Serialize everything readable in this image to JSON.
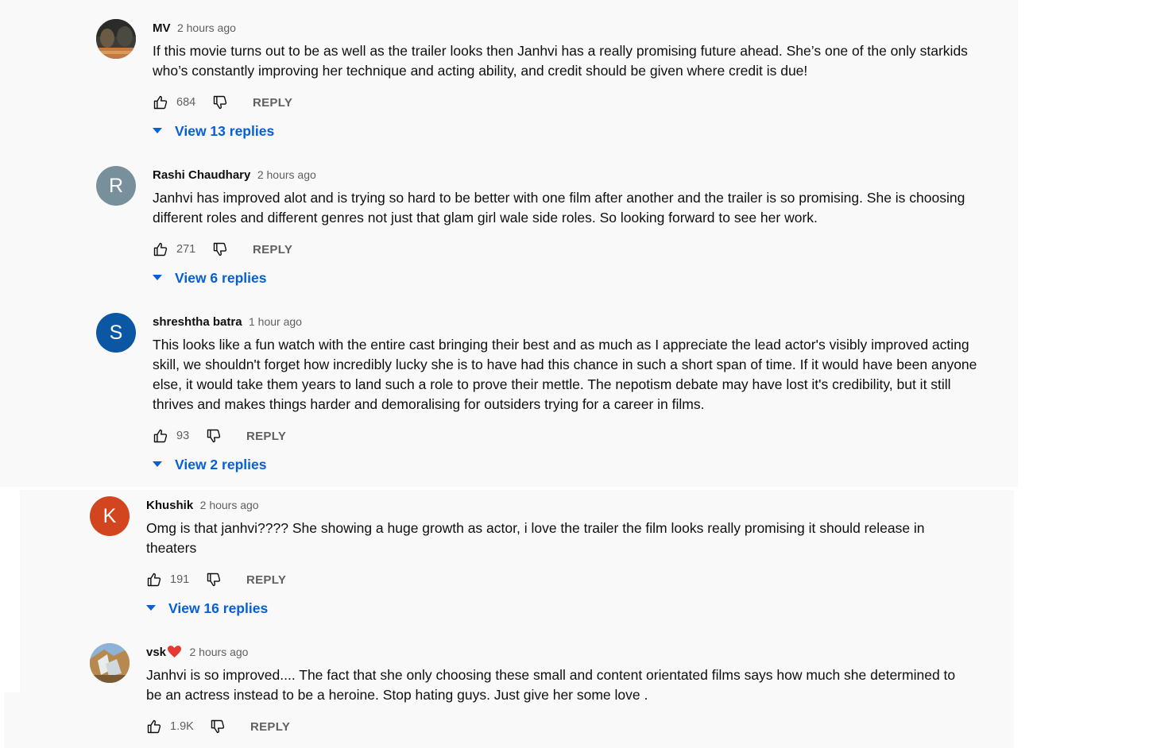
{
  "comments": [
    {
      "author": "MV",
      "time": "2 hours ago",
      "text": "If this movie turns out to be as well as the trailer looks then Janhvi has a really  promising future ahead. She’s one of the only starkids who’s constantly improving her technique and acting ability, and credit should be given where credit is due!",
      "likes": "684",
      "reply_label": "REPLY",
      "replies_label": "View 13 replies",
      "avatar_letter": ""
    },
    {
      "author": "Rashi Chaudhary",
      "time": "2 hours ago",
      "text": "Janhvi has improved alot and is trying so hard to be better with one film after another and the trailer is so promising. She is choosing different roles and different genres not just that glam girl wale side roles. So looking forward to see her work.",
      "likes": "271",
      "reply_label": "REPLY",
      "replies_label": "View 6 replies",
      "avatar_letter": "R",
      "avatar_color": "#78909c"
    },
    {
      "author": "shreshtha batra",
      "time": "1 hour ago",
      "text": "This looks like a fun watch with the entire cast bringing their best and as much as I appreciate the lead actor's visibly improved acting skill, we shouldn't forget how incredibly lucky she is to have had this chance in such a short span of time. If it would have been anyone else, it would take them years to land such a role to prove their mettle. The nepotism debate may have lost it's credibility, but it still thrives and makes things harder and demoralising for outsiders trying for a career in films.",
      "likes": "93",
      "reply_label": "REPLY",
      "replies_label": "View 2 replies",
      "avatar_letter": "S",
      "avatar_color": "#0b57a4"
    },
    {
      "author": "Khushik",
      "time": "2 hours ago",
      "text": "Omg is that janhvi???? She showing a huge growth as actor, i love the trailer the film looks really promising it should release in theaters",
      "likes": "191",
      "reply_label": "REPLY",
      "replies_label": "View 16 replies",
      "avatar_letter": "K",
      "avatar_color": "#d2451e"
    },
    {
      "author": "vsk",
      "time": "2 hours ago",
      "text": "Janhvi is so improved.... The fact that she only choosing these small and content orientated films says how much she determined to be an actress instead to be a heroine. Stop hating guys. Just give her some love .",
      "likes": "1.9K",
      "reply_label": "REPLY",
      "avatar_letter": ""
    }
  ],
  "colors": {
    "background": "#f9f9f9",
    "text": "#0f0f0f",
    "secondary_text": "#606060",
    "link_blue": "#065fd4",
    "heart_red": "#e53935"
  },
  "icons": {
    "like": "thumb-up-icon",
    "dislike": "thumb-down-icon",
    "expand": "caret-down-icon",
    "heart": "heart-icon"
  }
}
